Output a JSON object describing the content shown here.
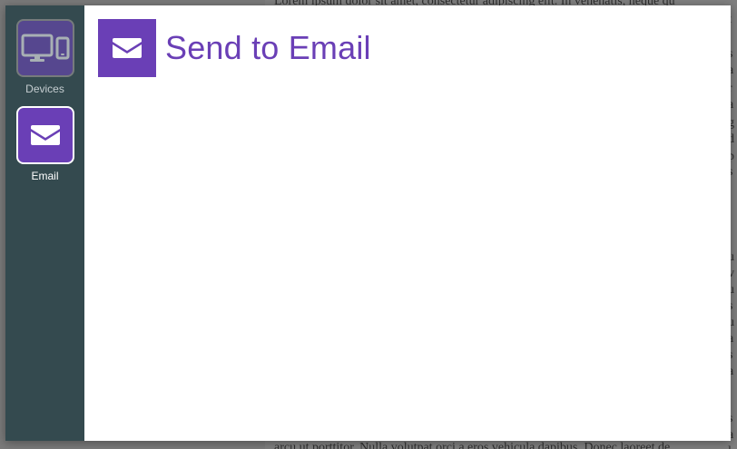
{
  "background": {
    "top_text": "Lorem ipsum dolor sit amet, consectetur adipiscing elit. In venenatis, neque qu",
    "bottom_text": "arcu ut porttitor. Nulla volutpat orci a eros vehicula dapibus. Donec laoreet de",
    "right_column": [
      "t",
      "s",
      "a",
      "r",
      "a",
      "g",
      "d",
      "p",
      "s",
      "u",
      "v",
      "u",
      "s",
      "u",
      "a",
      "s",
      "a",
      "s",
      "a",
      "l"
    ]
  },
  "sidebar": {
    "items": [
      {
        "label": "Devices",
        "icon": "devices-icon",
        "active": false
      },
      {
        "label": "Email",
        "icon": "email-icon",
        "active": true
      }
    ]
  },
  "main": {
    "title": "Send to Email",
    "icon": "email-icon"
  },
  "colors": {
    "accent": "#6a3fb6",
    "sidebar_bg": "#344a4f",
    "overlay_bg": "#7a7a7a"
  }
}
